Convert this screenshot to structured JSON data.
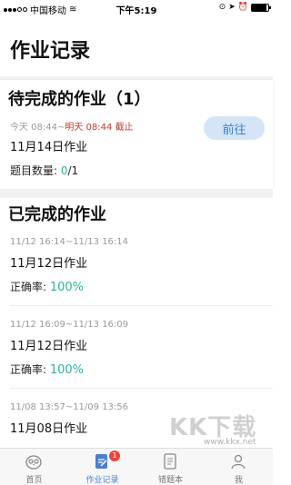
{
  "status_bar": {
    "carrier": "中国移动",
    "time": "下午5:19",
    "battery_level": 0.9
  },
  "header": {
    "title": "作业记录"
  },
  "pending": {
    "title": "待完成的作业（1）",
    "items": [
      {
        "start": "今天 08:44~",
        "deadline": "明天 08:44 截止",
        "name": "11月14日作业",
        "count_label": "题目数量: ",
        "count_done": "0",
        "count_total": "/1",
        "go_label": "前往"
      }
    ]
  },
  "completed": {
    "title": "已完成的作业",
    "items": [
      {
        "range": "11/12 16:14~11/13 16:14",
        "name": "11月12日作业",
        "accuracy_label": "正确率: ",
        "accuracy": "100%"
      },
      {
        "range": "11/12 16:09~11/13 16:09",
        "name": "11月12日作业",
        "accuracy_label": "正确率: ",
        "accuracy": "100%"
      },
      {
        "range": "11/08 13:57~11/09 13:56",
        "name": "11月08日作业",
        "accuracy_label": "",
        "accuracy": ""
      }
    ]
  },
  "tabbar": {
    "tabs": [
      {
        "label": "首页",
        "icon": "owl-icon"
      },
      {
        "label": "作业记录",
        "icon": "homework-icon",
        "badge": "1"
      },
      {
        "label": "错题本",
        "icon": "notebook-icon"
      },
      {
        "label": "我",
        "icon": "profile-icon"
      }
    ]
  },
  "watermark": {
    "text": "KK下载",
    "url": "www.kkx.net"
  },
  "colors": {
    "accent": "#4a7fd4",
    "success": "#2bb2a3",
    "deadline": "#c0392b",
    "badge": "#e8453c"
  }
}
